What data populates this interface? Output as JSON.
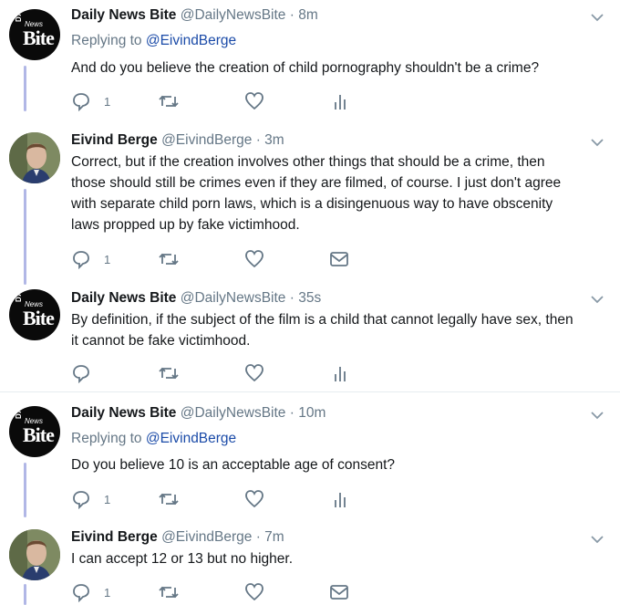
{
  "tweets": [
    {
      "avatar": "daily-news-bite-logo",
      "name": "Daily News Bite",
      "handle": "@DailyNewsBite",
      "dot": "·",
      "time": "8m",
      "replying_label": "Replying to",
      "replying_to": "@EivindBerge",
      "text": "And do you believe the creation of child pornography shouldn't be a crime?",
      "reply_count": "1",
      "last_action_icon": "analytics-icon"
    },
    {
      "avatar": "eivind-berge-photo",
      "name": "Eivind Berge",
      "handle": "@EivindBerge",
      "dot": "·",
      "time": "3m",
      "text_lines": [
        "Correct, but if the creation involves other things that should be a crime, then",
        "those should still be crimes even if they are filmed, of course. I just don't agree",
        "with separate child porn laws, which is a disingenuous way to have obscenity",
        "laws propped up by fake victimhood."
      ],
      "reply_count": "1",
      "last_action_icon": "message-icon"
    },
    {
      "avatar": "daily-news-bite-logo",
      "name": "Daily News Bite",
      "handle": "@DailyNewsBite",
      "dot": "·",
      "time": "35s",
      "text_lines": [
        "By definition, if the subject of the film is a child that cannot legally have sex, then",
        "it cannot be fake victimhood."
      ],
      "reply_count": "",
      "last_action_icon": "analytics-icon"
    },
    {
      "avatar": "daily-news-bite-logo",
      "name": "Daily News Bite",
      "handle": "@DailyNewsBite",
      "dot": "·",
      "time": "10m",
      "replying_label": "Replying to",
      "replying_to": "@EivindBerge",
      "text": "Do you believe 10 is an acceptable age of consent?",
      "reply_count": "1",
      "last_action_icon": "analytics-icon"
    },
    {
      "avatar": "eivind-berge-photo",
      "name": "Eivind Berge",
      "handle": "@EivindBerge",
      "dot": "·",
      "time": "7m",
      "text": "I can accept 12 or 13 but no higher.",
      "reply_count": "1",
      "last_action_icon": "message-icon"
    }
  ],
  "colors": {
    "thread_line": "#b1b7e6",
    "mention": "#1b4ba8",
    "muted": "#657786"
  }
}
